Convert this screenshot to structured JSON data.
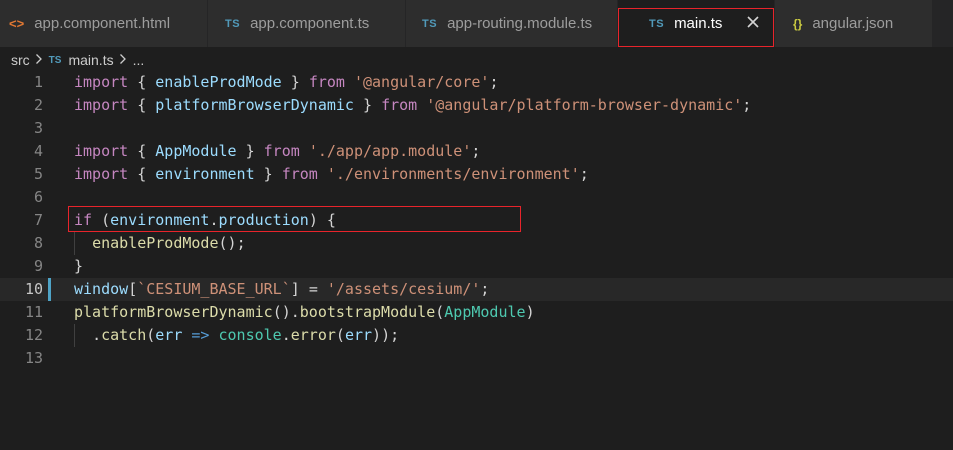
{
  "tabs": [
    {
      "icon": "<>",
      "icon_type": "html",
      "label": "app.component.html"
    },
    {
      "icon": "TS",
      "icon_type": "ts",
      "label": "app.component.ts"
    },
    {
      "icon": "TS",
      "icon_type": "ts",
      "label": "app-routing.module.ts"
    },
    {
      "icon": "TS",
      "icon_type": "ts",
      "label": "main.ts",
      "active": true
    },
    {
      "icon": "{}",
      "icon_type": "json",
      "label": "angular.json"
    }
  ],
  "breadcrumb": {
    "folder": "src",
    "file_icon": "TS",
    "file": "main.ts",
    "more": "..."
  },
  "editor": {
    "current_line": 10,
    "lines": [
      {
        "n": "1",
        "text": "import { enableProdMode } from '@angular/core';"
      },
      {
        "n": "2",
        "text": "import { platformBrowserDynamic } from '@angular/platform-browser-dynamic';"
      },
      {
        "n": "3",
        "text": ""
      },
      {
        "n": "4",
        "text": "import { AppModule } from './app/app.module';"
      },
      {
        "n": "5",
        "text": "import { environment } from './environments/environment';"
      },
      {
        "n": "6",
        "text": ""
      },
      {
        "n": "7",
        "text": "if (environment.production) {"
      },
      {
        "n": "8",
        "text": "  enableProdMode();"
      },
      {
        "n": "9",
        "text": "}"
      },
      {
        "n": "10",
        "text": "window[`CESIUM_BASE_URL`] = '/assets/cesium/';"
      },
      {
        "n": "11",
        "text": "platformBrowserDynamic().bootstrapModule(AppModule)"
      },
      {
        "n": "12",
        "text": "  .catch(err => console.error(err));"
      },
      {
        "n": "13",
        "text": ""
      }
    ]
  },
  "colors": {
    "highlight_box": "#e8242b",
    "keyword": "#c586c0",
    "variable": "#9cdcfe",
    "function": "#dcdcaa",
    "string": "#ce9178",
    "type": "#4ec9b0"
  }
}
